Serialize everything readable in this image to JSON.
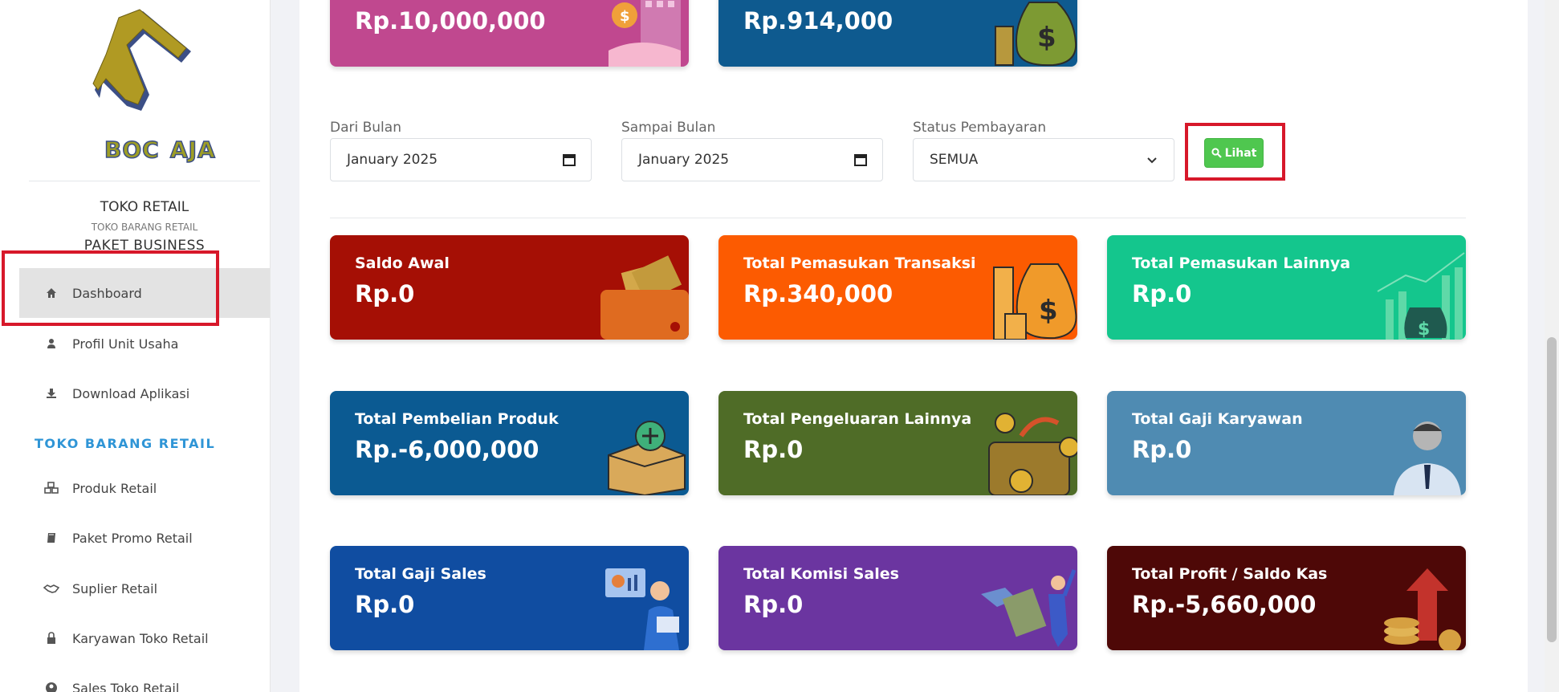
{
  "sidebar": {
    "logo_text": "BOC AJA",
    "store_name": "TOKO RETAIL",
    "store_subtitle": "TOKO BARANG RETAIL",
    "store_package": "PAKET BUSINESS",
    "items": [
      {
        "label": "Dashboard",
        "icon": "home-icon",
        "active": true
      },
      {
        "label": "Profil Unit Usaha",
        "icon": "user-icon"
      },
      {
        "label": "Download Aplikasi",
        "icon": "download-icon"
      }
    ],
    "section_title": "TOKO BARANG RETAIL",
    "section_items": [
      {
        "label": "Produk Retail",
        "icon": "cubes-icon"
      },
      {
        "label": "Paket Promo Retail",
        "icon": "book-icon"
      },
      {
        "label": "Suplier Retail",
        "icon": "handshake-icon"
      },
      {
        "label": "Karyawan Toko Retail",
        "icon": "lock-icon"
      },
      {
        "label": "Sales Toko Retail",
        "icon": "user-circle-icon"
      }
    ]
  },
  "top_cards": [
    {
      "value": "Rp.10,000,000",
      "color": "#c0488f"
    },
    {
      "value": "Rp.914,000",
      "color": "#0e5a8f"
    }
  ],
  "filters": {
    "from_label": "Dari Bulan",
    "from_value": "January 2025",
    "to_label": "Sampai Bulan",
    "to_value": "January 2025",
    "status_label": "Status Pembayaran",
    "status_value": "SEMUA",
    "button_label": "Lihat"
  },
  "cards": [
    {
      "label": "Saldo Awal",
      "value": "Rp.0",
      "color": "#a50f05",
      "icon": "wallet-icon"
    },
    {
      "label": "Total Pemasukan Transaksi",
      "value": "Rp.340,000",
      "color": "#fc5b01",
      "icon": "money-bag-icon"
    },
    {
      "label": "Total Pemasukan Lainnya",
      "value": "Rp.0",
      "color": "#14c68d",
      "icon": "growth-chart-icon"
    },
    {
      "label": "Total Pembelian Produk",
      "value": "Rp.-6,000,000",
      "color": "#0b5a92",
      "icon": "box-add-icon"
    },
    {
      "label": "Total Pengeluaran Lainnya",
      "value": "Rp.0",
      "color": "#4f6c27",
      "icon": "wallet-out-icon"
    },
    {
      "label": "Total Gaji Karyawan",
      "value": "Rp.0",
      "color": "#4f8bb2",
      "icon": "employee-icon"
    },
    {
      "label": "Total Gaji Sales",
      "value": "Rp.0",
      "color": "#104da1",
      "icon": "sales-person-icon"
    },
    {
      "label": "Total Komisi Sales",
      "value": "Rp.0",
      "color": "#6b35a0",
      "icon": "commission-icon"
    },
    {
      "label": "Total Profit / Saldo Kas",
      "value": "Rp.-5,660,000",
      "color": "#4e0807",
      "icon": "profit-icon"
    }
  ],
  "colors": {
    "accent_section": "#2f95d6",
    "button_green": "#4fc74f",
    "highlight_red": "#d7182a"
  }
}
